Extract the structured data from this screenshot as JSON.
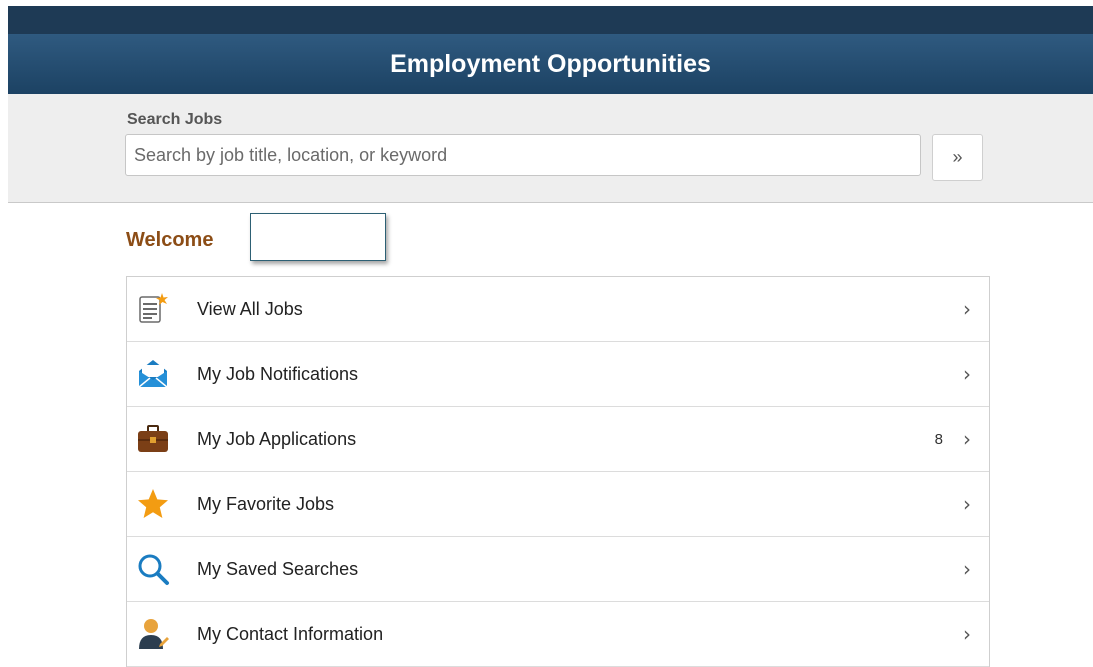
{
  "header": {
    "title": "Employment Opportunities"
  },
  "search": {
    "label": "Search Jobs",
    "placeholder": "Search by job title, location, or keyword",
    "value": "",
    "go_label": "»"
  },
  "welcome": {
    "label": "Welcome",
    "name": ""
  },
  "menu": {
    "items": [
      {
        "label": "View All Jobs",
        "icon": "job-list-icon",
        "count": ""
      },
      {
        "label": "My Job Notifications",
        "icon": "envelope-icon",
        "count": ""
      },
      {
        "label": "My Job Applications",
        "icon": "briefcase-icon",
        "count": "8"
      },
      {
        "label": "My Favorite Jobs",
        "icon": "star-icon",
        "count": ""
      },
      {
        "label": "My Saved Searches",
        "icon": "magnifier-icon",
        "count": ""
      },
      {
        "label": "My Contact Information",
        "icon": "contact-person-icon",
        "count": ""
      }
    ],
    "chevron": "›"
  },
  "colors": {
    "header_bg": "#1c4263",
    "welcome_text": "#8c4d16",
    "star": "#f39c12",
    "envelope": "#1a7cc1",
    "briefcase": "#7b3f16"
  }
}
